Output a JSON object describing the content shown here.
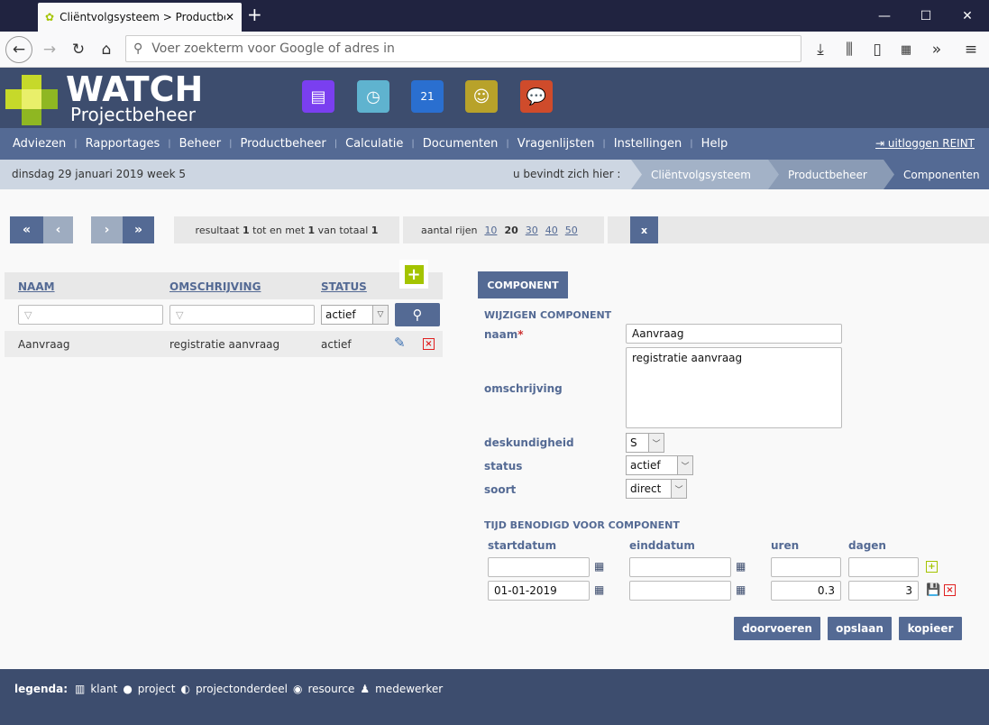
{
  "browser": {
    "tab_title": "Cliëntvolgsysteem > Productbeheer",
    "url_placeholder": "Voer zoekterm voor Google of adres in"
  },
  "app": {
    "logo_title": "WATCH",
    "logo_subtitle": "Projectbeheer",
    "app_icons": [
      "documents-icon",
      "clock-icon",
      "calendar-icon",
      "people-icon",
      "chat-icon"
    ]
  },
  "nav": {
    "items": [
      "Adviezen",
      "Rapportages",
      "Beheer",
      "Productbeheer",
      "Calculatie",
      "Documenten",
      "Vragenlijsten",
      "Instellingen",
      "Help"
    ],
    "logout": "uitloggen REINT"
  },
  "crumbbar": {
    "date": "dinsdag 29 januari 2019",
    "week": "week 5",
    "here": "u bevindt zich hier :",
    "crumbs": [
      "Cliëntvolgsysteem",
      "Productbeheer",
      "Componenten"
    ]
  },
  "pager": {
    "first": "«",
    "prev": "‹",
    "next": "›",
    "last": "»",
    "result_pre": "resultaat",
    "from": "1",
    "mid": "tot en met",
    "to": "1",
    "of": "van totaal",
    "total": "1",
    "rows_label": "aantal rijen",
    "rows_options": [
      "10",
      "20",
      "30",
      "40",
      "50"
    ],
    "rows_selected": "20"
  },
  "list": {
    "headers": [
      "NAAM",
      "OMSCHRIJVING",
      "STATUS"
    ],
    "status_filter": "actief",
    "rows": [
      {
        "naam": "Aanvraag",
        "omschrijving": "registratie aanvraag",
        "status": "actief"
      }
    ]
  },
  "form": {
    "tab": "COMPONENT",
    "section": "WIJZIGEN COMPONENT",
    "naam_label": "naam",
    "required": "*",
    "naam": "Aanvraag",
    "omschrijving_label": "omschrijving",
    "omschrijving": "registratie aanvraag",
    "deskundigheid_label": "deskundigheid",
    "deskundigheid": "S",
    "status_label": "status",
    "status": "actief",
    "soort_label": "soort",
    "soort": "direct"
  },
  "time": {
    "section": "TIJD BENODIGD VOOR COMPONENT",
    "headers": [
      "startdatum",
      "einddatum",
      "uren",
      "dagen"
    ],
    "rows": [
      {
        "start": "",
        "end": "",
        "uren": "",
        "dagen": ""
      },
      {
        "start": "01-01-2019",
        "end": "",
        "uren": "0.3",
        "dagen": "3"
      }
    ]
  },
  "buttons": {
    "doorvoeren": "doorvoeren",
    "opslaan": "opslaan",
    "kopieer": "kopieer"
  },
  "legend": {
    "label": "legenda:",
    "items": [
      "klant",
      "project",
      "projectonderdeel",
      "resource",
      "medewerker"
    ]
  },
  "colors": {
    "header": "#3d4d6e",
    "nav": "#546a94",
    "accent_green": "#a4c400",
    "delete_red": "#e02020"
  }
}
